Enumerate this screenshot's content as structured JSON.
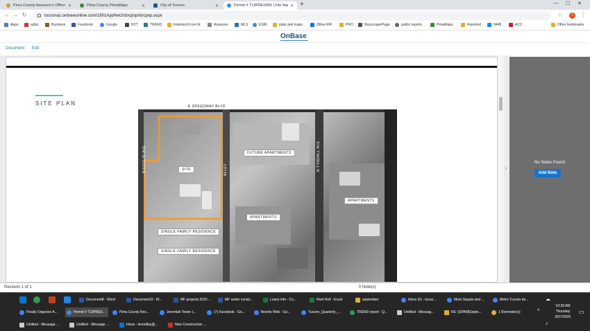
{
  "tabs": [
    {
      "label": "Pima County Assessor's Office",
      "color": "#c5a04a"
    },
    {
      "label": "Pima County PimaMaps",
      "color": "#3b8a3b"
    },
    {
      "label": "City of Tucson",
      "color": "#1b5b8f"
    },
    {
      "label": "Permit # T19PRE0066 | File Nam...",
      "color": "#2e9ad6"
    }
  ],
  "address": {
    "url": "tucsonaz.onbaseonline.com/1801AppNet2/docpop/docpop.aspx",
    "profile_initial": "!"
  },
  "bookmarks": [
    {
      "label": "Apps",
      "color": "#4a7bd0"
    },
    {
      "label": "azbiz",
      "color": "#cc3333"
    },
    {
      "label": "Business",
      "color": "#8b5a2b"
    },
    {
      "label": "Facebook",
      "color": "#3b5998"
    },
    {
      "label": "Google",
      "color": "#4285f4"
    },
    {
      "label": "NYT",
      "color": "#444444"
    },
    {
      "label": "TREND",
      "color": "#2a7a8a"
    },
    {
      "label": "Imported From IE",
      "color": "#e0b030"
    },
    {
      "label": "Assessor",
      "color": "#888888"
    },
    {
      "label": "MLS",
      "color": "#2c6fb2"
    },
    {
      "label": "ESRI",
      "color": "#3a8fd0"
    },
    {
      "label": "plats and maps",
      "color": "#e0b030"
    },
    {
      "label": "Zillow RM",
      "color": "#1277e1"
    },
    {
      "label": "PRO",
      "color": "#e0b030"
    },
    {
      "label": "SkyscraperPage",
      "color": "#555555"
    },
    {
      "label": "public reports",
      "color": "#666666"
    },
    {
      "label": "PimaMaps",
      "color": "#3b8a3b"
    },
    {
      "label": "Imported",
      "color": "#e0b030"
    },
    {
      "label": "844$",
      "color": "#1e88e5"
    },
    {
      "label": "ACC",
      "color": "#cc2222"
    },
    {
      "label": "Other bookmarks",
      "color": "#e0b030"
    }
  ],
  "onbase": {
    "logo": "OnBase",
    "menu_document": "Document",
    "menu_edit": "Edit"
  },
  "sitePlan": {
    "title": "SITE PLAN",
    "streets": {
      "top": "E SPEEDWAY BLVD",
      "left": "N EUCLID AVE",
      "alley": "ALLEY",
      "right": "N TYNDALL AVE"
    },
    "labels": {
      "site": "SITE",
      "futureApartments": "FUTURE APARTMENTS",
      "apartments": "APARTMENTS",
      "apartments2": "APARTMENTS",
      "sfr1": "SINGLE FAMILY RESIDENCE",
      "sfr2": "SINGLE FAMILY RESIDENCE"
    }
  },
  "notes": {
    "empty": "No Notes Found",
    "button": "Add Note"
  },
  "status": {
    "revision": "Revision 1 of 1",
    "notes": "0 Note(s)"
  },
  "taskbar": {
    "row1": [
      {
        "label": "Document8 - Word",
        "color": "#2b579a"
      },
      {
        "label": "Document10 - W...",
        "color": "#2b579a"
      },
      {
        "label": "MF projects.2020 ...",
        "color": "#2b579a"
      },
      {
        "label": "MF under constr...",
        "color": "#2b579a"
      },
      {
        "label": "Loans info - Co...",
        "color": "#217346"
      },
      {
        "label": "Rent Roll - Excel",
        "color": "#217346"
      },
      {
        "label": "september",
        "color": "#e0b030"
      },
      {
        "label": "Inbox (6) - tucso...",
        "color": "#4285f4"
      },
      {
        "label": "More Squats and ...",
        "color": "#4285f4"
      },
      {
        "label": "Metro Tucson de...",
        "color": "#4285f4"
      }
    ],
    "row2": [
      {
        "label": "Finally Organize A...",
        "color": "#4285f4"
      },
      {
        "label": "Permit # T19PRE0...",
        "color": "#4285f4"
      },
      {
        "label": "Pima County Rec...",
        "color": "#4285f4"
      },
      {
        "label": "Jeremiah Tower (...",
        "color": "#4285f4"
      },
      {
        "label": "(7) Facebook - Go...",
        "color": "#4285f4"
      },
      {
        "label": "flexmls Web - Go...",
        "color": "#4285f4"
      },
      {
        "label": "Tucson_Quarterly_...",
        "color": "#4285f4"
      },
      {
        "label": "TREND report - Q...",
        "color": "#2e9d4e"
      },
      {
        "label": "Untitled - Messag...",
        "color": "#cccccc"
      },
      {
        "label": "RE: [SPAM]Septe...",
        "color": "#e0b030"
      },
      {
        "label": "1 Reminder(s)",
        "color": "#e0b030"
      }
    ],
    "row3": [
      {
        "label": "Untitled - Message ...",
        "color": "#cccccc"
      },
      {
        "label": "Untitled - Message ...",
        "color": "#cccccc"
      },
      {
        "label": "Inbox - lsmedley@...",
        "color": "#0078d4"
      },
      {
        "label": "New Construction ...",
        "color": "#c0392b"
      }
    ],
    "clock": {
      "time": "10:39 AM",
      "day": "Thursday",
      "date": "8/27/2020"
    }
  }
}
